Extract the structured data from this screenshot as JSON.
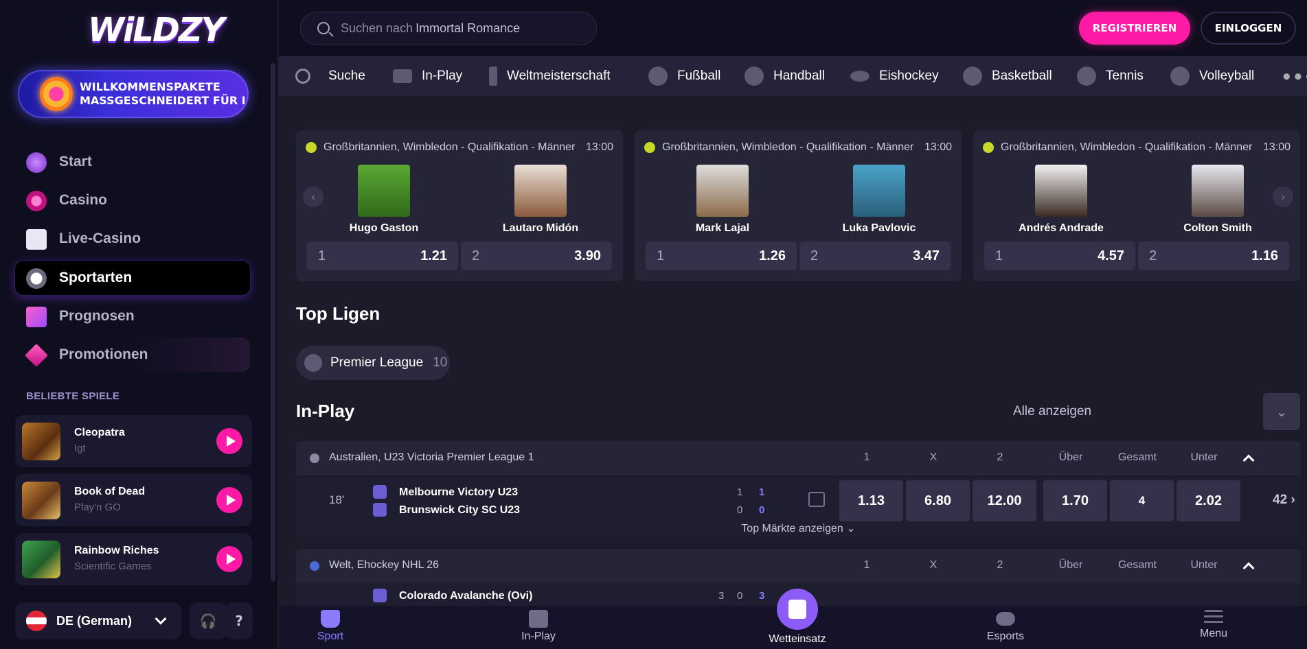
{
  "brand": {
    "logo": "WiLDZY"
  },
  "banner": {
    "line1": "WILLKOMMENSPAKETE",
    "line2": "MASSGESCHNEIDERT FÜR DIC..."
  },
  "sidebar": {
    "nav": [
      {
        "label": "Start",
        "icon": "potion-icon"
      },
      {
        "label": "Casino",
        "icon": "casino-chip-icon"
      },
      {
        "label": "Live-Casino",
        "icon": "playing-cards-icon"
      },
      {
        "label": "Sportarten",
        "icon": "soccer-ball-icon",
        "active": true
      },
      {
        "label": "Prognosen",
        "icon": "chart-trend-icon"
      },
      {
        "label": "Promotionen",
        "icon": "diamond-icon"
      }
    ],
    "section_title": "BELIEBTE SPIELE",
    "games": [
      {
        "title": "Cleopatra",
        "provider": "Igt"
      },
      {
        "title": "Book of Dead",
        "provider": "Play'n GO"
      },
      {
        "title": "Rainbow Riches",
        "provider": "Scientific Games"
      }
    ],
    "language": "DE (German)",
    "support_glyph": "🎧",
    "help_glyph": "?"
  },
  "header": {
    "search_prefix": "Suchen nach",
    "search_term": "Immortal Romance",
    "register": "REGISTRIEREN",
    "login": "EINLOGGEN"
  },
  "sportnav": [
    {
      "label": "Suche",
      "icon": "search-icon"
    },
    {
      "label": "In-Play",
      "icon": "live-icon"
    },
    {
      "label": "Weltmeisterschaft",
      "icon": "trophy-icon"
    },
    {
      "label": "Fußball",
      "icon": "soccer-icon"
    },
    {
      "label": "Handball",
      "icon": "handball-icon"
    },
    {
      "label": "Eishockey",
      "icon": "puck-icon"
    },
    {
      "label": "Basketball",
      "icon": "basketball-icon"
    },
    {
      "label": "Tennis",
      "icon": "tennis-icon"
    },
    {
      "label": "Volleyball",
      "icon": "volleyball-icon"
    }
  ],
  "featured": [
    {
      "league": "Großbritannien, Wimbledon - Qualifikation - Männer",
      "time": "13:00",
      "p1": "Hugo Gaston",
      "p2": "Lautaro Midón",
      "o1": "1.21",
      "o2": "3.90"
    },
    {
      "league": "Großbritannien, Wimbledon - Qualifikation - Männer",
      "time": "13:00",
      "p1": "Mark Lajal",
      "p2": "Luka Pavlovic",
      "o1": "1.26",
      "o2": "3.47"
    },
    {
      "league": "Großbritannien, Wimbledon - Qualifikation - Männer",
      "time": "13:00",
      "p1": "Andrés Andrade",
      "p2": "Colton Smith",
      "o1": "4.57",
      "o2": "1.16"
    }
  ],
  "odd_labels": {
    "one": "1",
    "two": "2"
  },
  "top_leagues": {
    "title": "Top Ligen",
    "league": "Premier League",
    "count": "10"
  },
  "inplay": {
    "title": "In-Play",
    "all": "Alle anzeigen",
    "cols": {
      "c1": "1",
      "cx": "X",
      "c2": "2",
      "over": "Über",
      "total": "Gesamt",
      "under": "Unter"
    },
    "l1": {
      "name": "Australien, U23 Victoria Premier League 1",
      "minute": "18'",
      "home": "Melbourne Victory U23",
      "away": "Brunswick City SC U23",
      "home_s1": "1",
      "home_s2": "1",
      "away_s1": "0",
      "away_s2": "0",
      "odds": [
        "1.13",
        "6.80",
        "12.00",
        "1.70",
        "4",
        "2.02"
      ],
      "more": "42",
      "top_markets": "Top Märkte anzeigen"
    },
    "l2": {
      "name": "Welt, Ehockey NHL 26",
      "home": "Colorado Avalanche (Ovi)",
      "home_s1": "3",
      "home_s2": "0",
      "home_s3": "3"
    }
  },
  "bottom": [
    {
      "label": "Sport",
      "active": true
    },
    {
      "label": "In-Play"
    },
    {
      "label": "Wetteinsatz"
    },
    {
      "label": "Esports"
    },
    {
      "label": "Menu"
    }
  ]
}
